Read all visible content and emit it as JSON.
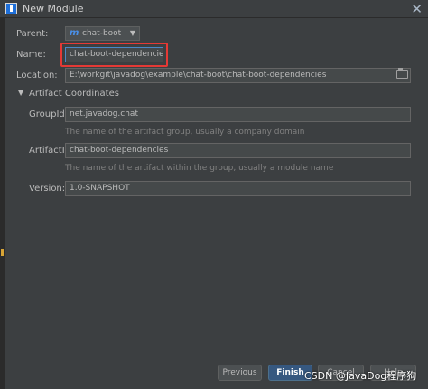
{
  "window": {
    "title": "New Module",
    "close_glyph": "✕"
  },
  "form": {
    "parent": {
      "label": "Parent:",
      "value": "chat-boot",
      "icon_glyph": "m"
    },
    "name": {
      "label": "Name:",
      "value": "chat-boot-dependencies"
    },
    "location": {
      "label": "Location:",
      "value": "E:\\workgit\\javadog\\example\\chat-boot\\chat-boot-dependencies"
    }
  },
  "artifact": {
    "section_label": "Artifact Coordinates",
    "group_id": {
      "label": "GroupId:",
      "value": "net.javadog.chat",
      "hint": "The name of the artifact group, usually a company domain"
    },
    "artifact_id": {
      "label": "ArtifactId:",
      "value": "chat-boot-dependencies",
      "hint": "The name of the artifact within the group, usually a module name"
    },
    "version": {
      "label": "Version:",
      "value": "1.0-SNAPSHOT"
    }
  },
  "buttons": {
    "previous": "Previous",
    "finish": "Finish",
    "cancel": "Cancel",
    "help": "Help"
  },
  "watermark": "CSDN @JavaDog程序狗",
  "colors": {
    "accent": "#365880",
    "highlight": "#e53935",
    "background": "#3c3f41"
  }
}
